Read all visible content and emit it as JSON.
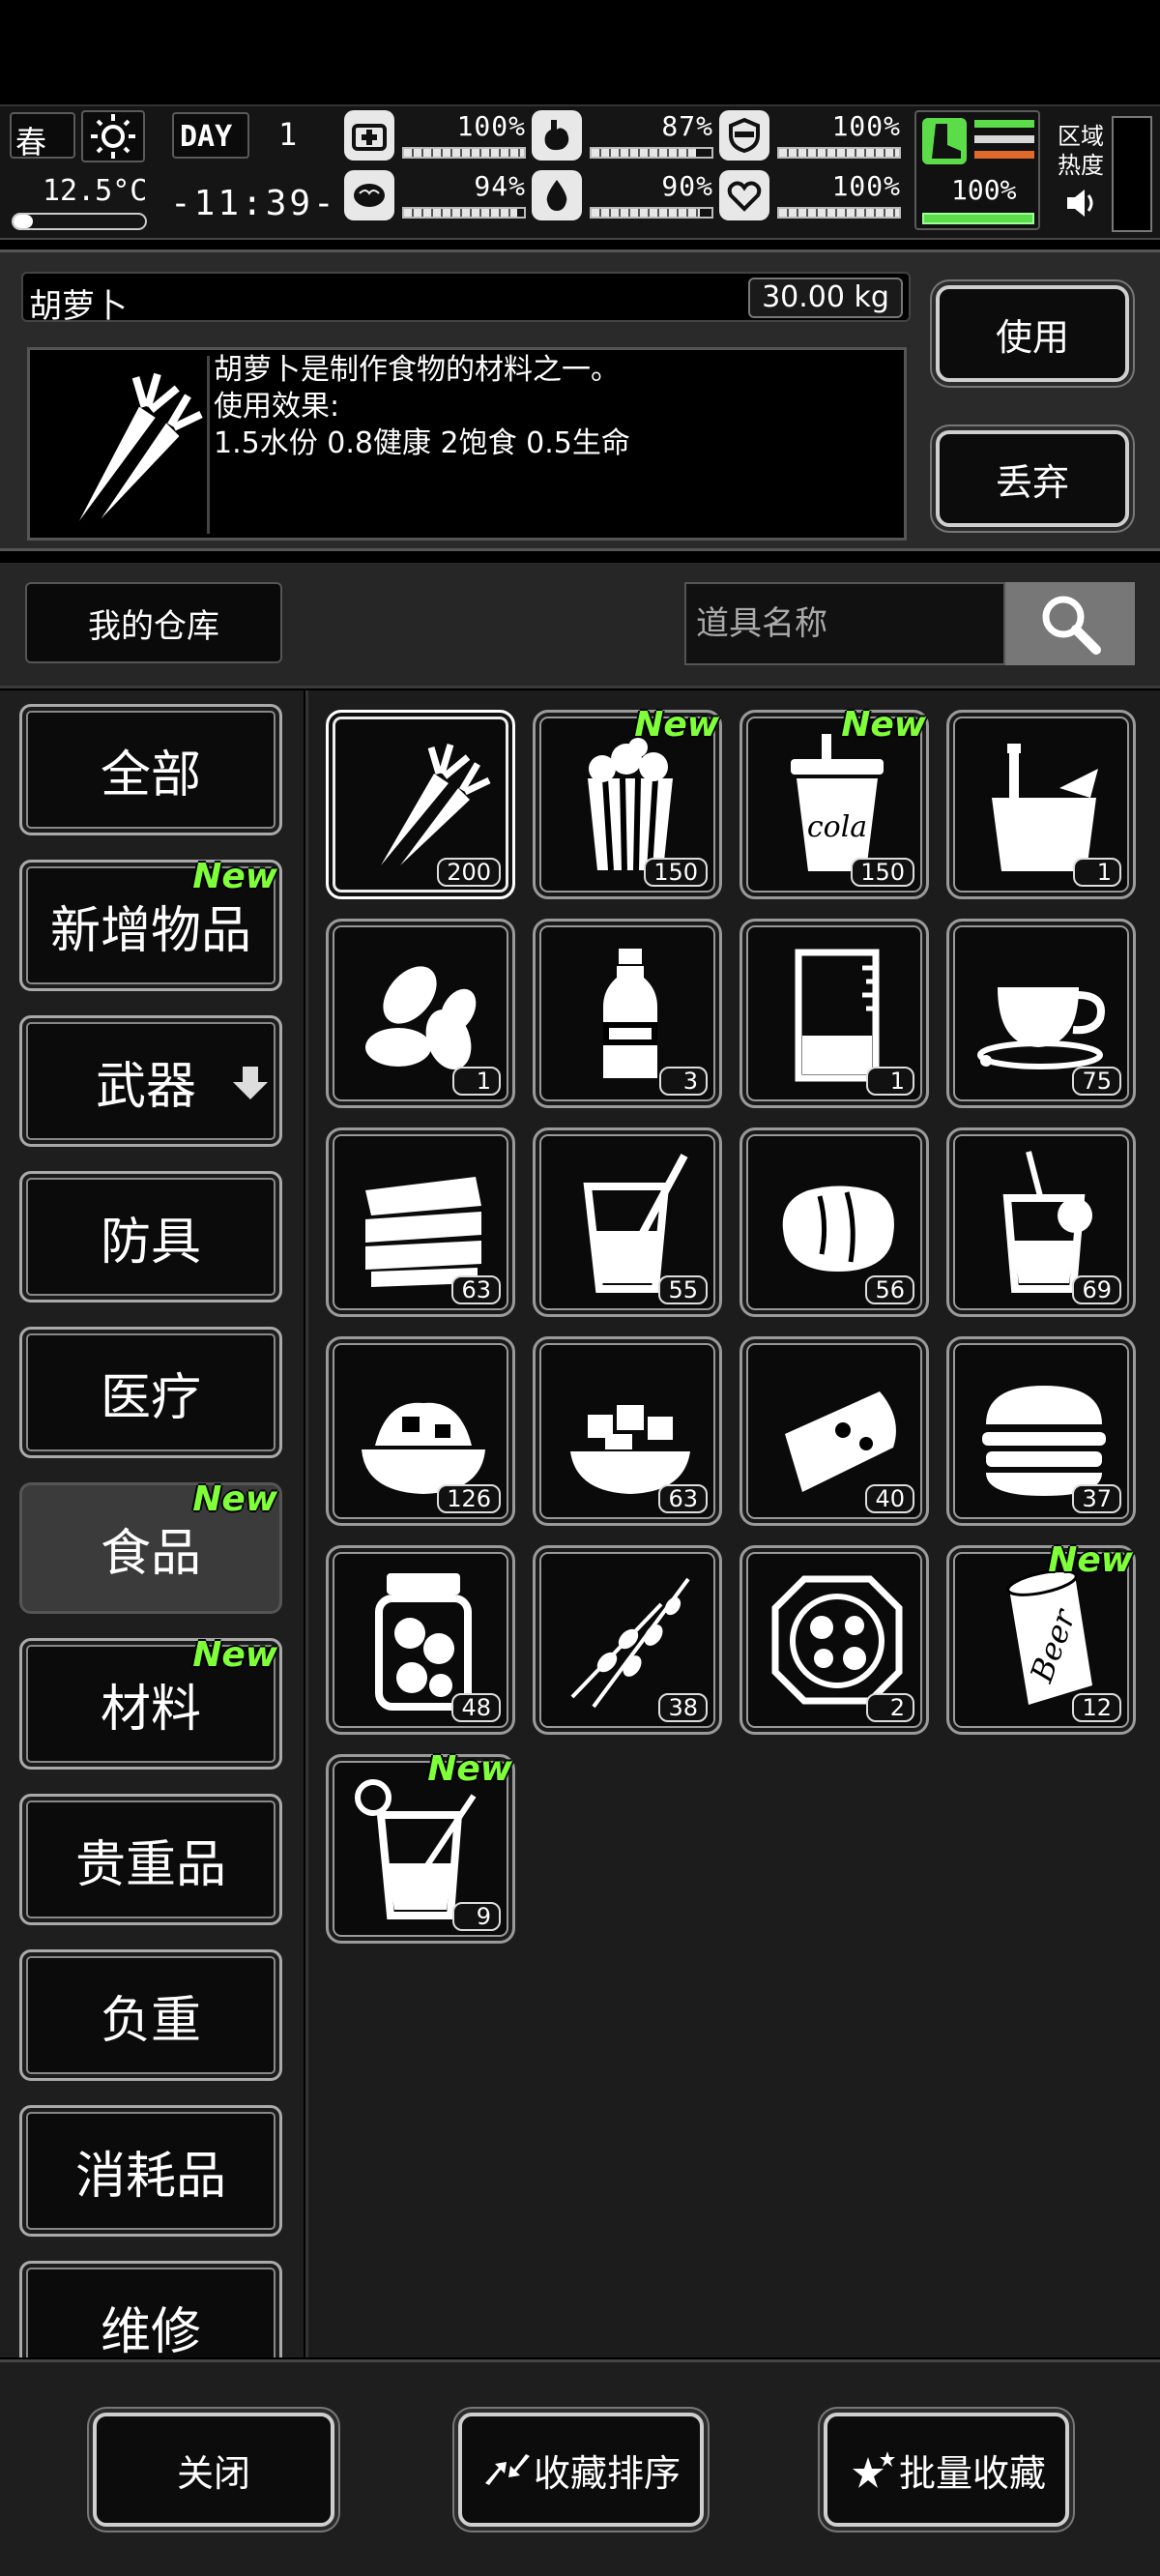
{
  "status": {
    "season": "春",
    "temperature": "12.5°C",
    "day_label": "DAY",
    "day_number": "1",
    "clock": "-11:39-",
    "stats": [
      {
        "icon": "first-aid-icon",
        "value": "100%",
        "level": 1.0
      },
      {
        "icon": "stomach-icon",
        "value": "87%",
        "level": 0.87
      },
      {
        "icon": "shield-icon",
        "value": "100%",
        "level": 1.0
      },
      {
        "icon": "brain-icon",
        "value": "94%",
        "level": 0.94
      },
      {
        "icon": "water-drop-icon",
        "value": "90%",
        "level": 0.9
      },
      {
        "icon": "heart-icon",
        "value": "100%",
        "level": 1.0
      }
    ],
    "stamina": "100%",
    "area_heat_line1": "区域",
    "area_heat_line2": "热度"
  },
  "detail": {
    "name": "胡萝卜",
    "weight": "30.00 kg",
    "lines": [
      "胡萝卜是制作食物的材料之一。",
      "使用效果:",
      "1.5水份 0.8健康 2饱食 0.5生命"
    ],
    "use_label": "使用",
    "discard_label": "丢弃"
  },
  "warehouse": {
    "title": "我的仓库",
    "search_placeholder": "道具名称"
  },
  "new_badge": "New",
  "categories": [
    {
      "label": "全部",
      "new": false,
      "active": false
    },
    {
      "label": "新增物品",
      "new": true,
      "active": false
    },
    {
      "label": "武器",
      "new": false,
      "active": false,
      "arrow": true
    },
    {
      "label": "防具",
      "new": false,
      "active": false
    },
    {
      "label": "医疗",
      "new": false,
      "active": false
    },
    {
      "label": "食品",
      "new": true,
      "active": true
    },
    {
      "label": "材料",
      "new": true,
      "active": false
    },
    {
      "label": "贵重品",
      "new": false,
      "active": false
    },
    {
      "label": "负重",
      "new": false,
      "active": false
    },
    {
      "label": "消耗品",
      "new": false,
      "active": false
    },
    {
      "label": "维修",
      "new": false,
      "active": false
    }
  ],
  "items": [
    {
      "icon": "carrot-icon",
      "qty": "200",
      "new": false,
      "selected": true
    },
    {
      "icon": "popcorn-icon",
      "qty": "150",
      "new": true
    },
    {
      "icon": "cola-cup-icon",
      "qty": "150",
      "new": true,
      "text": "cola"
    },
    {
      "icon": "ice-bucket-icon",
      "qty": "1",
      "new": false
    },
    {
      "icon": "almonds-icon",
      "qty": "1",
      "new": false
    },
    {
      "icon": "water-bottle-icon",
      "qty": "3",
      "new": false
    },
    {
      "icon": "beaker-icon",
      "qty": "1",
      "new": false
    },
    {
      "icon": "coffee-cup-icon",
      "qty": "75",
      "new": false
    },
    {
      "icon": "sandwich-icon",
      "qty": "63",
      "new": false
    },
    {
      "icon": "juice-glass-icon",
      "qty": "55",
      "new": false
    },
    {
      "icon": "bread-icon",
      "qty": "56",
      "new": false
    },
    {
      "icon": "lemonade-icon",
      "qty": "69",
      "new": false
    },
    {
      "icon": "food-bowl-icon",
      "qty": "126",
      "new": false
    },
    {
      "icon": "tofu-bowl-icon",
      "qty": "63",
      "new": false
    },
    {
      "icon": "pizza-slice-icon",
      "qty": "40",
      "new": false
    },
    {
      "icon": "burger-icon",
      "qty": "37",
      "new": false
    },
    {
      "icon": "pickle-jar-icon",
      "qty": "48",
      "new": false
    },
    {
      "icon": "skewers-icon",
      "qty": "38",
      "new": false
    },
    {
      "icon": "hotpot-icon",
      "qty": "2",
      "new": false
    },
    {
      "icon": "beer-can-icon",
      "qty": "12",
      "new": true,
      "text": "Beer"
    },
    {
      "icon": "cocktail-icon",
      "qty": "9",
      "new": true
    }
  ],
  "footer": {
    "close_label": "关闭",
    "sort_label": "收藏排序",
    "batch_label": "批量收藏"
  }
}
